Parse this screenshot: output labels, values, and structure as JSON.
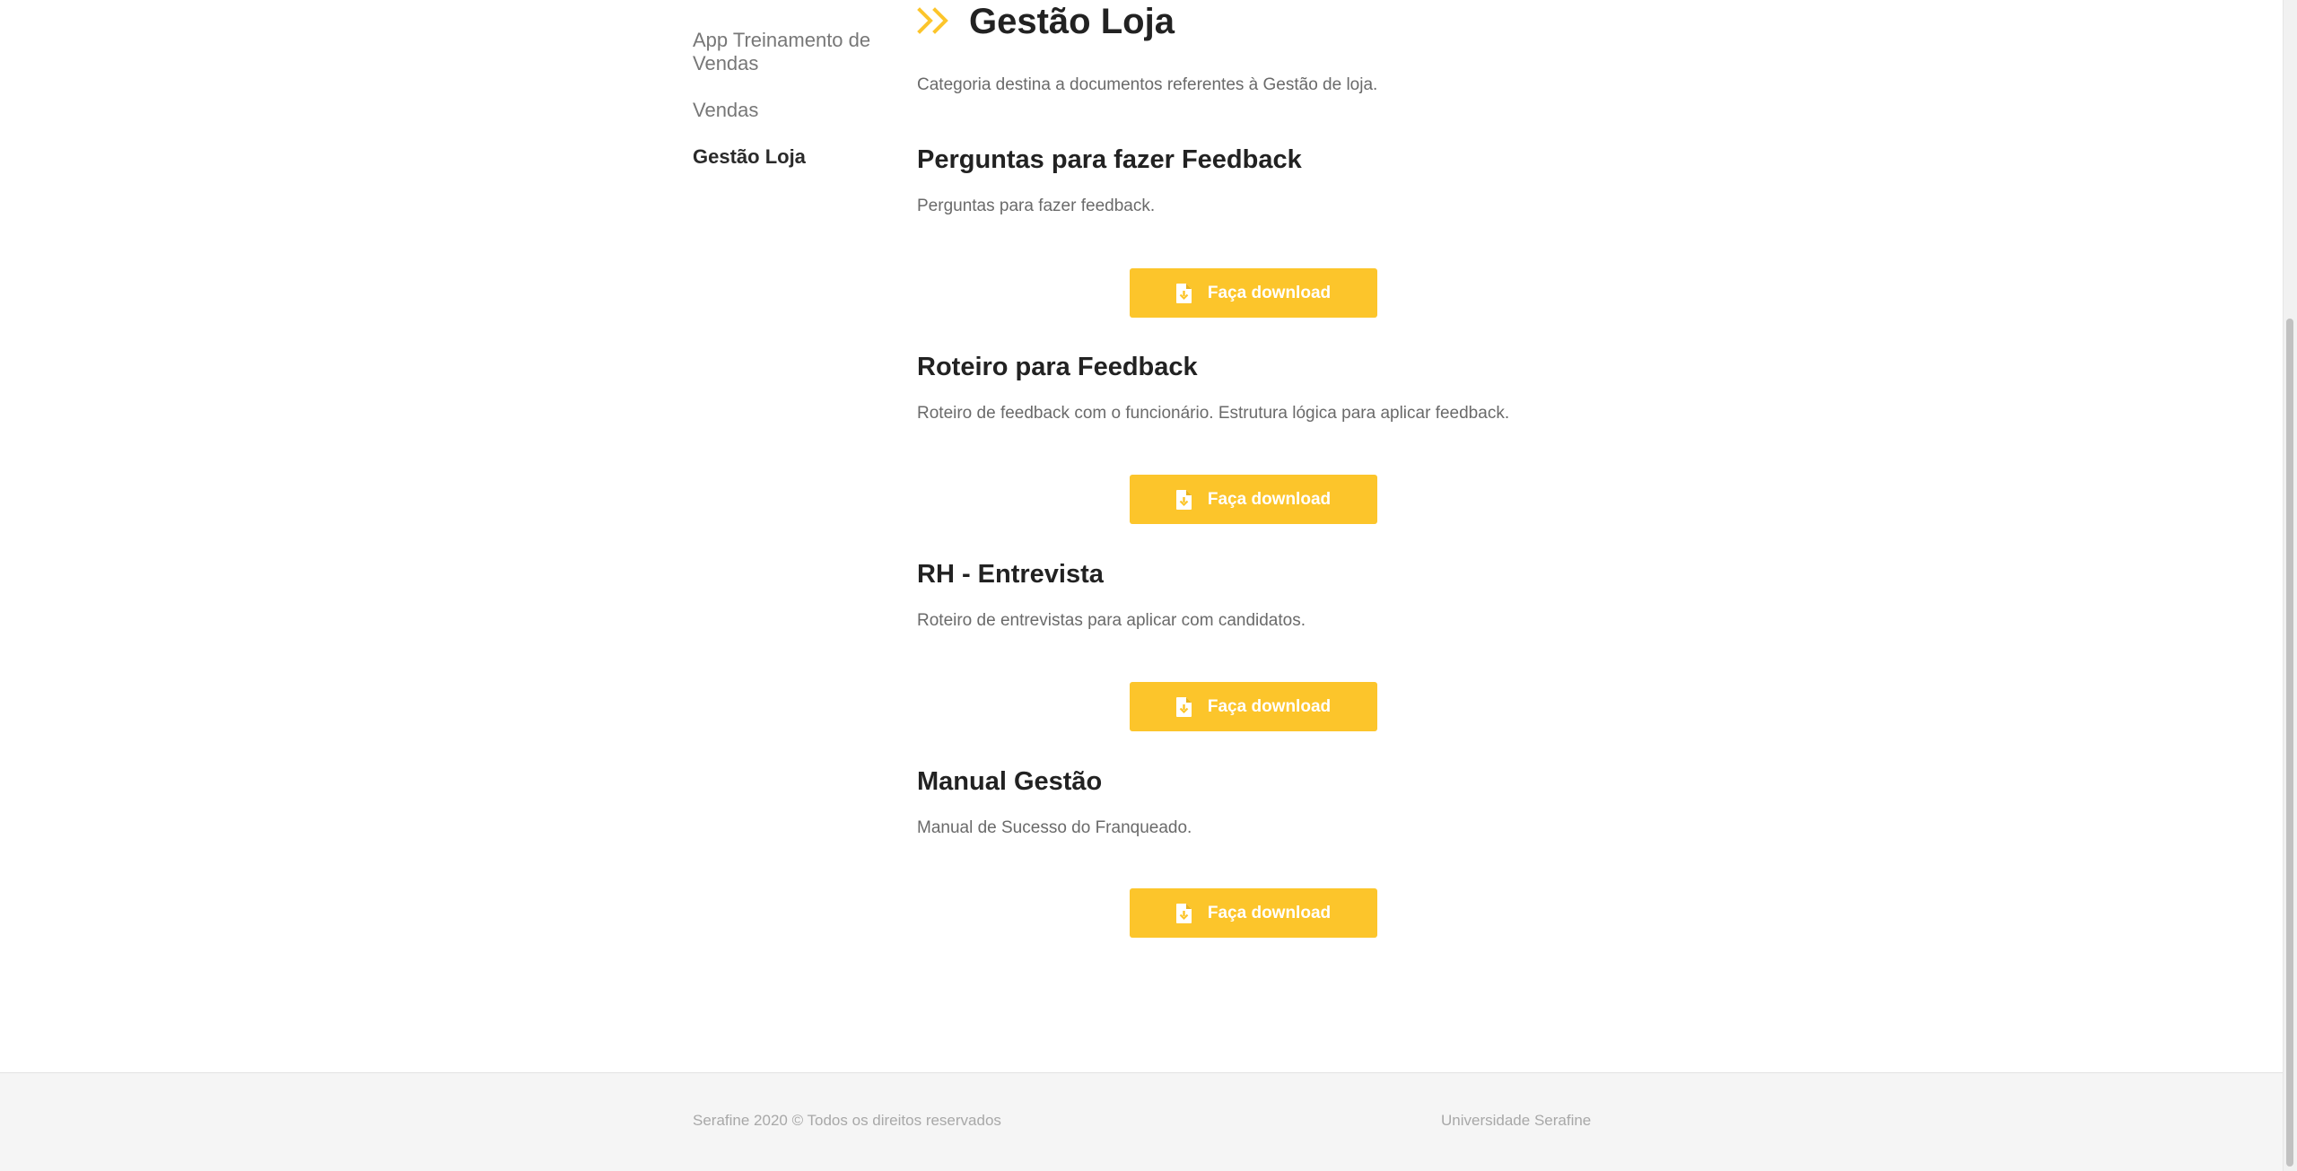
{
  "sidebar": {
    "items": [
      {
        "label": "App Treinamento de Vendas",
        "active": false
      },
      {
        "label": "Vendas",
        "active": false
      },
      {
        "label": "Gestão Loja",
        "active": true
      }
    ]
  },
  "main": {
    "title": "Gestão Loja",
    "title_icon": "double-chevron-right-icon",
    "description": "Categoria destina a documentos referentes à Gestão de loja.",
    "documents": [
      {
        "title": "Perguntas para fazer Feedback",
        "description": "Perguntas para fazer feedback.",
        "button_label": "Faça download"
      },
      {
        "title": "Roteiro para Feedback",
        "description": "Roteiro de feedback com o funcionário. Estrutura lógica para aplicar feedback.",
        "button_label": "Faça download"
      },
      {
        "title": "RH - Entrevista",
        "description": "Roteiro de entrevistas para aplicar com candidatos.",
        "button_label": "Faça download"
      },
      {
        "title": "Manual Gestão",
        "description": "Manual de Sucesso do Franqueado.",
        "button_label": "Faça download"
      }
    ]
  },
  "footer": {
    "copyright": "Serafine 2020 © Todos os direitos reservados",
    "brand": "Universidade Serafine"
  },
  "colors": {
    "accent": "#fcc52b",
    "text_dark": "#222222",
    "text_muted": "#6a6a6a",
    "footer_bg": "#f5f5f5"
  },
  "icons": {
    "button_icon": "file-download-icon"
  }
}
